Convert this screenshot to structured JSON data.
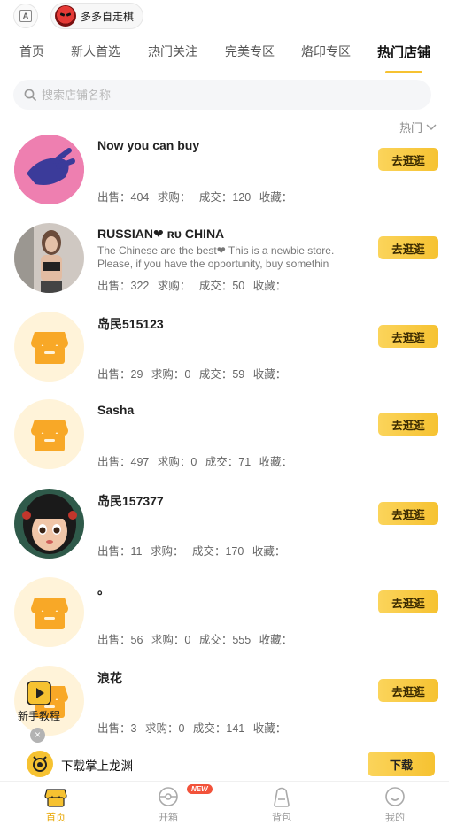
{
  "topbar": {
    "a_icon": "A",
    "game_name": "多多自走棋"
  },
  "tabs": [
    {
      "label": "首页"
    },
    {
      "label": "新人首选"
    },
    {
      "label": "热门关注"
    },
    {
      "label": "完美专区"
    },
    {
      "label": "烙印专区"
    },
    {
      "label": "热门店铺",
      "active": true
    }
  ],
  "search": {
    "placeholder": "搜索店铺名称"
  },
  "sort": {
    "label": "热门"
  },
  "visit_label": "去逛逛",
  "shops": [
    {
      "name": "Now you can buy",
      "desc": "",
      "stats": {
        "sell": "出售：404",
        "buy": "求购：",
        "deal": "成交：120",
        "fav": "收藏："
      }
    },
    {
      "name": "RUSSIAN❤ ʀᴜ CHINA",
      "desc": "The Chinese are the best❤ This is a newbie store. Please, if you have the opportunity, buy somethin",
      "stats": {
        "sell": "出售：322",
        "buy": "求购：",
        "deal": "成交：50",
        "fav": "收藏："
      }
    },
    {
      "name": "岛民515123",
      "desc": "",
      "stats": {
        "sell": "出售：29",
        "buy": "求购：0",
        "deal": "成交：59",
        "fav": "收藏："
      }
    },
    {
      "name": "Sasha",
      "desc": "",
      "stats": {
        "sell": "出售：497",
        "buy": "求购：0",
        "deal": "成交：71",
        "fav": "收藏："
      }
    },
    {
      "name": "岛民157377",
      "desc": "",
      "stats": {
        "sell": "出售：11",
        "buy": "求购：",
        "deal": "成交：170",
        "fav": "收藏："
      }
    },
    {
      "name": "。",
      "desc": "",
      "stats": {
        "sell": "出售：56",
        "buy": "求购：0",
        "deal": "成交：555",
        "fav": "收藏："
      }
    },
    {
      "name": "浪花",
      "desc": "",
      "stats": {
        "sell": "出售：3",
        "buy": "求购：0",
        "deal": "成交：141",
        "fav": "收藏："
      }
    }
  ],
  "tutorial": {
    "label": "新手教程"
  },
  "download": {
    "text": "下载掌上龙渊",
    "button": "下载"
  },
  "bottom_nav": [
    {
      "label": "首页",
      "icon": "shop-icon",
      "active": true
    },
    {
      "label": "开箱",
      "icon": "box-open-icon",
      "badge": "NEW"
    },
    {
      "label": "背包",
      "icon": "backpack-icon"
    },
    {
      "label": "我的",
      "icon": "profile-icon"
    }
  ],
  "colors": {
    "accent": "#f6c231",
    "accent_light": "#fbd45b",
    "badge_red": "#f2523a"
  }
}
